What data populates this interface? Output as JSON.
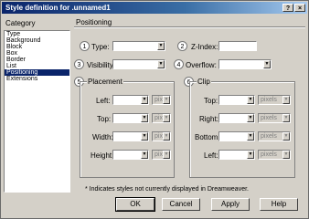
{
  "window": {
    "title": "Style definition for .unnamed1"
  },
  "category": {
    "label": "Category",
    "items": [
      "Type",
      "Background",
      "Block",
      "Box",
      "Border",
      "List",
      "Positioning",
      "Extensions"
    ],
    "selected_index": 6
  },
  "panel": {
    "title": "Positioning",
    "type": {
      "label": "Type:",
      "value": ""
    },
    "z_index": {
      "label": "Z-Index:",
      "value": ""
    },
    "visibility": {
      "label": "Visibility:",
      "value": ""
    },
    "overflow": {
      "label": "Overflow:",
      "value": ""
    },
    "placement": {
      "title": "Placement",
      "left": {
        "label": "Left:",
        "unit": "pixels"
      },
      "top": {
        "label": "Top:",
        "unit": "pixels"
      },
      "width": {
        "label": "Width:",
        "unit": "pixels"
      },
      "height": {
        "label": "Height:",
        "unit": "pixels"
      }
    },
    "clip": {
      "title": "Clip",
      "top": {
        "label": "Top:",
        "unit": "pixels"
      },
      "right": {
        "label": "Right:",
        "unit": "pixels"
      },
      "bottom": {
        "label": "Bottom:",
        "unit": "pixels"
      },
      "left": {
        "label": "Left:",
        "unit": "pixels"
      }
    },
    "note": "* Indicates styles not currently displayed in Dreamweaver."
  },
  "callouts": [
    "1",
    "2",
    "3",
    "4",
    "5",
    "6"
  ],
  "buttons": {
    "ok": "OK",
    "cancel": "Cancel",
    "apply": "Apply",
    "help": "Help"
  },
  "titlebar_buttons": {
    "help": "?",
    "close": "×"
  },
  "dropdown_arrow": "▼",
  "colors": {
    "titlebar": "#0a246a",
    "selection": "#0a246a",
    "dialog_bg": "#d4d0c8"
  }
}
